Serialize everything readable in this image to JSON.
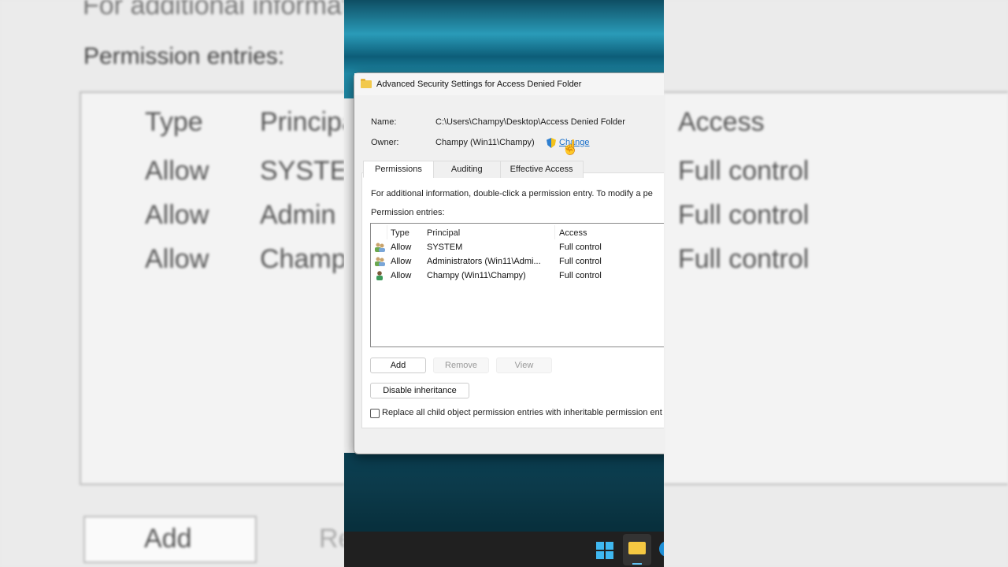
{
  "dialog": {
    "title": "Advanced Security Settings for Access Denied Folder",
    "name_label": "Name:",
    "name_value": "C:\\Users\\Champy\\Desktop\\Access Denied Folder",
    "owner_label": "Owner:",
    "owner_value": "Champy (Win11\\Champy)",
    "change_link": "Change",
    "tabs": [
      {
        "label": "Permissions",
        "active": true
      },
      {
        "label": "Auditing",
        "active": false
      },
      {
        "label": "Effective Access",
        "active": false
      }
    ],
    "info_text": "For additional information, double-click a permission entry. To modify a pe",
    "entries_label": "Permission entries:",
    "columns": {
      "type": "Type",
      "principal": "Principal",
      "access": "Access"
    },
    "entries": [
      {
        "icon": "group-icon",
        "type": "Allow",
        "principal": "SYSTEM",
        "access": "Full control"
      },
      {
        "icon": "group-icon",
        "type": "Allow",
        "principal": "Administrators (Win11\\Admi...",
        "access": "Full control"
      },
      {
        "icon": "user-icon",
        "type": "Allow",
        "principal": "Champy (Win11\\Champy)",
        "access": "Full control"
      }
    ],
    "buttons": {
      "add": "Add",
      "remove": "Remove",
      "view": "View",
      "disable_inheritance": "Disable inheritance"
    },
    "replace_checkbox": {
      "label": "Replace all child object permission entries with inheritable permission ent",
      "checked": false
    }
  },
  "background_blur": {
    "top_text": "For additional information, double-click a permission entry. To modify a pe",
    "principal_partial": [
      "SYSTEM",
      "Admin",
      "Champ"
    ],
    "remove_partial": "Re"
  }
}
